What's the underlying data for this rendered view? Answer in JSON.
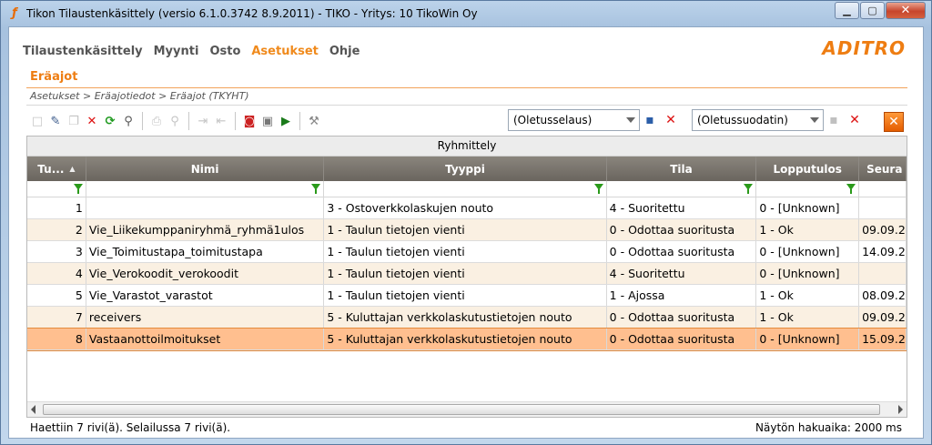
{
  "window": {
    "title": "Tikon Tilaustenkäsittely (versio 6.1.0.3742 8.9.2011) - TIKO - Yritys: 10 TikoWin Oy"
  },
  "menu": {
    "items": [
      "Tilaustenkäsittely",
      "Myynti",
      "Osto",
      "Asetukset",
      "Ohje"
    ],
    "active": "Asetukset"
  },
  "logo": "ADITRO",
  "page": {
    "title": "Eräajot",
    "breadcrumb": "Asetukset > Eräajotiedot > Eräajot  (TKYHT)"
  },
  "toolbar": {
    "view_combo": "(Oletusselaus)",
    "filter_combo": "(Oletussuodatin)",
    "icons": [
      "new-icon",
      "edit-icon",
      "copy-icon",
      "delete-icon",
      "refresh-icon",
      "search-icon",
      "print-icon",
      "print-preview-icon",
      "export-icon",
      "import-icon",
      "stop-icon",
      "settings-icon",
      "run-icon",
      "tools-icon"
    ]
  },
  "grid": {
    "group_label": "Ryhmittely",
    "columns": [
      "Tu...",
      "Nimi",
      "Tyyppi",
      "Tila",
      "Lopputulos",
      "Seura"
    ],
    "rows": [
      [
        "1",
        "",
        "3  -  Ostoverkkolaskujen nouto",
        "4  -  Suoritettu",
        "0  -  [Unknown]",
        ""
      ],
      [
        "2",
        "Vie_Liikekumppaniryhmä_ryhmä1ulos",
        "1  -  Taulun tietojen vienti",
        "0  -  Odottaa suoritusta",
        "1  -  Ok",
        "09.09.2"
      ],
      [
        "3",
        "Vie_Toimitustapa_toimitustapa",
        "1  -  Taulun tietojen vienti",
        "0  -  Odottaa suoritusta",
        "0  -  [Unknown]",
        "14.09.2"
      ],
      [
        "4",
        "Vie_Verokoodit_verokoodit",
        "1  -  Taulun tietojen vienti",
        "4  -  Suoritettu",
        "0  -  [Unknown]",
        ""
      ],
      [
        "5",
        "Vie_Varastot_varastot",
        "1  -  Taulun tietojen vienti",
        "1  -  Ajossa",
        "1  -  Ok",
        "08.09.2"
      ],
      [
        "7",
        "receivers",
        "5  -  Kuluttajan verkkolaskutustietojen nouto",
        "0  -  Odottaa suoritusta",
        "1  -  Ok",
        "09.09.2"
      ],
      [
        "8",
        "Vastaanottoilmoitukset",
        "5  -  Kuluttajan verkkolaskutustietojen nouto",
        "0  -  Odottaa suoritusta",
        "0  -  [Unknown]",
        "15.09.2"
      ]
    ],
    "selected_row": 6
  },
  "status": {
    "left": "Haettiin 7 rivi(ä). Selailussa 7 rivi(ä).",
    "right": "Näytön hakuaika: 2000 ms"
  },
  "colors": {
    "accent": "#ee7d12",
    "selected_row": "#ffbf8f",
    "header": "#7a756d"
  }
}
